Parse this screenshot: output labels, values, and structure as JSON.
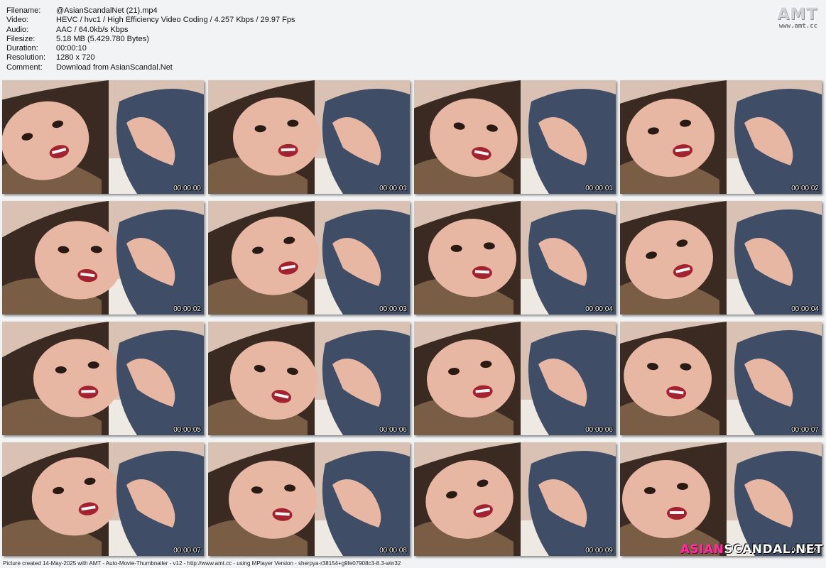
{
  "info": [
    {
      "key": "Filename:",
      "value": "@AsianScandalNet (21).mp4"
    },
    {
      "key": "Video:",
      "value": "HEVC / hvc1 / High Efficiency Video Coding / 4.257 Kbps / 29.97 Fps"
    },
    {
      "key": "Audio:",
      "value": "AAC / 64.0kb/s Kbps"
    },
    {
      "key": "Filesize:",
      "value": "5.18 MB (5.429.780 Bytes)"
    },
    {
      "key": "Duration:",
      "value": "00:00:10"
    },
    {
      "key": "Resolution:",
      "value": "1280 x 720"
    },
    {
      "key": "Comment:",
      "value": "Download from AsianScandal.Net"
    }
  ],
  "logo": {
    "big": "AMT",
    "small": "www.amt.cc"
  },
  "thumbnails": [
    "00:00:00",
    "00:00:01",
    "00:00:01",
    "00:00:02",
    "00:00:02",
    "00:00:03",
    "00:00:04",
    "00:00:04",
    "00:00:05",
    "00:00:06",
    "00:00:06",
    "00:00:07",
    "00:00:07",
    "00:00:08",
    "00:00:09",
    "00:00:09"
  ],
  "footer": "Picture created 14-May-2025 with AMT - Auto-Movie-Thumbnailer - v12 - http://www.amt.cc - using MPlayer Version - sherpya-r38154+g9fe07908c3-8.3-win32",
  "brand": {
    "part1": "ASIAN",
    "part2": "SCANDAL.NET"
  },
  "colors": {
    "background": "#f2f3f5",
    "brand_pink": "#ff2f9e",
    "sweater": "#3f4d66",
    "skin": "#e8b7a3"
  }
}
